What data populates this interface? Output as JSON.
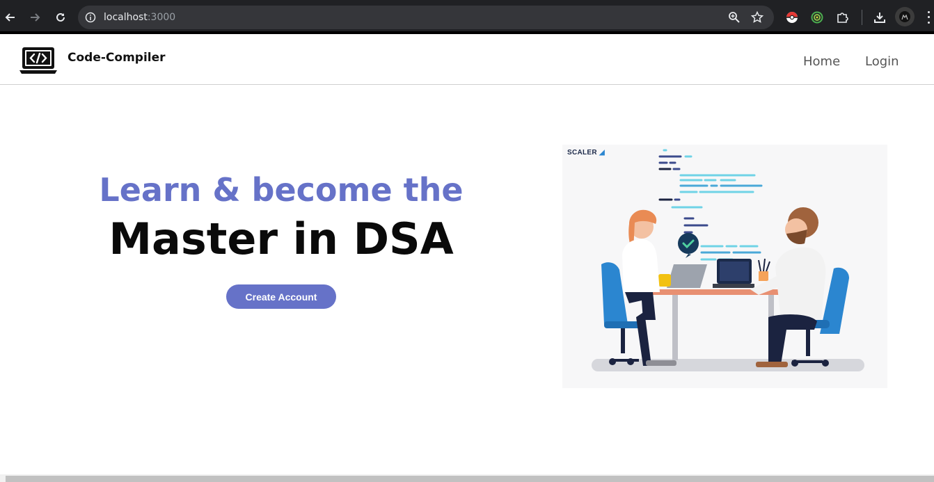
{
  "browser": {
    "url_host": "localhost",
    "url_port": ":3000"
  },
  "navbar": {
    "brand": "Code-Compiler",
    "links": [
      "Home",
      "Login"
    ]
  },
  "hero": {
    "headline_line1": "Learn & become the",
    "headline_line2": "Master in DSA",
    "cta_label": "Create Account",
    "image_watermark": "SCALER"
  },
  "colors": {
    "accent": "#6672c8",
    "chair_blue": "#2b86d0",
    "desk_orange": "#e89072"
  },
  "icons": [
    "back-icon",
    "forward-icon",
    "reload-icon",
    "info-icon",
    "zoom-icon",
    "star-icon",
    "pokeball-extension-icon",
    "target-extension-icon",
    "puzzle-extension-icon",
    "download-icon",
    "profile-avatar-icon",
    "kebab-menu-icon",
    "code-laptop-logo-icon"
  ]
}
